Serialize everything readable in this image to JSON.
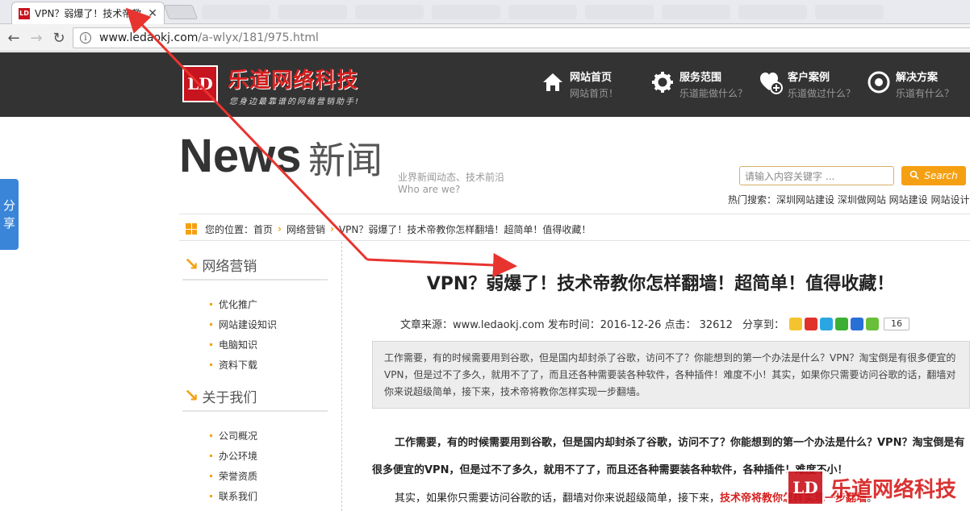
{
  "browser": {
    "tab_title": "VPN？弱爆了！技术帝教",
    "favicon": "LD",
    "url_host": "www.ledaokj.com",
    "url_path": "/a-wlyx/181/975.html"
  },
  "header": {
    "logo_mark": "LD",
    "logo_text": "乐道网络科技",
    "slogan": "您身边最靠谱的网络营销助手!",
    "nav": [
      {
        "title": "网站首页",
        "sub": "网站首页！",
        "icon": "home-icon"
      },
      {
        "title": "服务范围",
        "sub": "乐道能做什么？",
        "icon": "gear-icon"
      },
      {
        "title": "客户案例",
        "sub": "乐道做过什么？",
        "icon": "heart-plus-icon"
      },
      {
        "title": "解决方案",
        "sub": "乐道有什么？",
        "icon": "disc-icon"
      }
    ]
  },
  "share_tab": {
    "line1": "分",
    "line2": "享"
  },
  "banner": {
    "big": "News",
    "cn": "新闻",
    "sub1": "业界新闻动态、技术前沿",
    "sub2": "Who are we?",
    "search_placeholder": "请输入内容关键字 ...",
    "search_label": "Search",
    "hot_search": "热门搜索：深圳网站建设 深圳做网站 网站建设 网站设计"
  },
  "breadcrumb": {
    "prefix": "您的位置：",
    "home": "首页",
    "cat": "网络营销",
    "current": "VPN？弱爆了！技术帝教你怎样翻墙！超简单！值得收藏！"
  },
  "sidebar": {
    "sec1_title": "网络营销",
    "sec1_items": [
      "优化推广",
      "网站建设知识",
      "电脑知识",
      "资料下载"
    ],
    "sec2_title": "关于我们",
    "sec2_items": [
      "公司概况",
      "办公环境",
      "荣誉资质",
      "联系我们"
    ]
  },
  "article": {
    "title": "VPN？弱爆了！技术帝教你怎样翻墙！超简单！值得收藏！",
    "meta": "文章来源：www.ledaokj.com 发布时间：2016-12-26 点击： 32612",
    "share_label": "分享到：",
    "share_count": "16",
    "summary": "工作需要，有的时候需要用到谷歌，但是国内却封杀了谷歌，访问不了？你能想到的第一个办法是什么？VPN？淘宝倒是有很多便宜的VPN，但是过不了多久，就用不了了，而且还各种需要装各种软件，各种插件！难度不小！其实，如果你只需要访问谷歌的话，翻墙对你来说超级简单，接下来，技术帝将教你怎样实现一步翻墙。",
    "para1": "工作需要，有的时候需要用到谷歌，但是国内却封杀了谷歌，访问不了？你能想到的第一个办法是什么？VPN？淘宝倒是有很多便宜的VPN，但是过不了多久，就用不了了，而且还各种需要装各种软件，各种插件！难度不小！",
    "para2_start": "其实，如果你只需要访问谷歌的话，翻墙对你来说超级简单，接下来，",
    "para2_link": "技术帝将教你怎样实现一步翻墙",
    "para2_end": "。"
  },
  "watermark": {
    "mark": "LD",
    "text": "乐道网络科技"
  },
  "colors": {
    "accent": "#f5a012",
    "brand_red": "#d61e1e",
    "arrow_red": "#e8342f",
    "header_bg": "#333333"
  }
}
